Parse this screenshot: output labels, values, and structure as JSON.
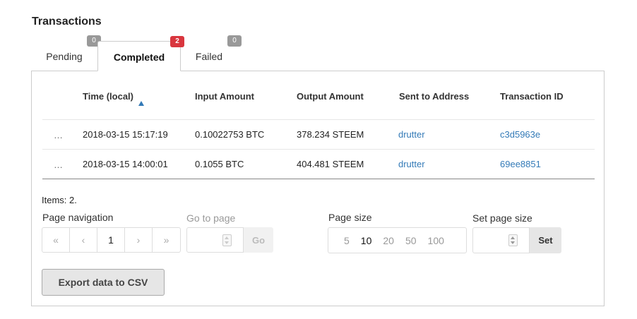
{
  "title": "Transactions",
  "tabs": [
    {
      "label": "Pending",
      "count": "0"
    },
    {
      "label": "Completed",
      "count": "2"
    },
    {
      "label": "Failed",
      "count": "0"
    }
  ],
  "table": {
    "columns": [
      "Time (local)",
      "Input Amount",
      "Output Amount",
      "Sent to Address",
      "Transaction ID"
    ],
    "rows": [
      {
        "menu": "…",
        "time": "2018-03-15 15:17:19",
        "input": "0.10022753 BTC",
        "output": "378.234 STEEM",
        "address": "drutter",
        "txid": "c3d5963e"
      },
      {
        "menu": "…",
        "time": "2018-03-15 14:00:01",
        "input": "0.1055 BTC",
        "output": "404.481 STEEM",
        "address": "drutter",
        "txid": "69ee8851"
      }
    ]
  },
  "items_text": "Items: 2.",
  "pagination": {
    "label": "Page navigation",
    "first": "«",
    "prev": "‹",
    "current": "1",
    "next": "›",
    "last": "»"
  },
  "goto": {
    "label": "Go to page",
    "button": "Go"
  },
  "page_size": {
    "label": "Page size",
    "options": [
      "5",
      "10",
      "20",
      "50",
      "100"
    ],
    "selected": "10"
  },
  "set_page_size": {
    "label": "Set page size",
    "button": "Set"
  },
  "export_button": "Export data to CSV",
  "colors": {
    "accent": "#337ab7",
    "badge_red": "#d9363e",
    "badge_gray": "#999999"
  }
}
